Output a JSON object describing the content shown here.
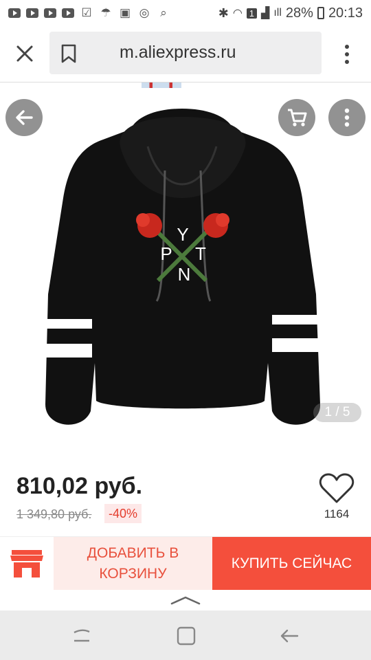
{
  "status": {
    "battery": "28%",
    "time": "20:13",
    "notif_count": "1"
  },
  "browser": {
    "url": "m.aliexpress.ru"
  },
  "gallery": {
    "counter": "1 / 5",
    "print_letters": [
      "Y",
      "P",
      "T",
      "N"
    ]
  },
  "product": {
    "price": "810,02 руб.",
    "old_price": "1 349,80 руб.",
    "discount": "-40%",
    "wishlist_count": "1164"
  },
  "actions": {
    "add_to_cart": "ДОБАВИТЬ В КОРЗИНУ",
    "buy_now": "КУПИТЬ СЕЙЧАС"
  },
  "colors": {
    "accent": "#f44f3c",
    "accent_light": "#fdece9"
  }
}
